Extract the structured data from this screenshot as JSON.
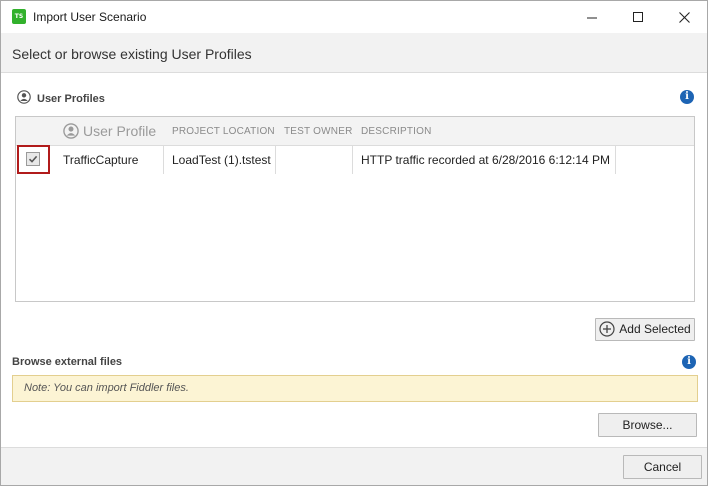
{
  "window": {
    "title": "Import User Scenario",
    "app_icon_text": "TS",
    "icons": {
      "minimize": "minimize-icon",
      "maximize": "maximize-icon",
      "close": "close-icon"
    }
  },
  "header": {
    "text": "Select or browse existing User Profiles"
  },
  "profiles_section": {
    "title": "User Profiles",
    "columns": {
      "profile": "User Profile",
      "location": "PROJECT LOCATION",
      "owner": "TEST OWNER",
      "description": "DESCRIPTION"
    },
    "rows": [
      {
        "checked": true,
        "profile": "TrafficCapture",
        "location": "LoadTest (1).tstest",
        "owner": "",
        "description": "HTTP traffic recorded at 6/28/2016 6:12:14 PM"
      }
    ],
    "add_button_label": "Add Selected"
  },
  "browse_section": {
    "title": "Browse external files",
    "note": "Note: You can import Fiddler files.",
    "browse_button_label": "Browse..."
  },
  "footer": {
    "cancel_label": "Cancel"
  },
  "colors": {
    "app_icon": "#32b12c",
    "info_icon": "#1d64b4",
    "highlight_border": "#b11b1b",
    "note_background": "#fcf4d4"
  }
}
